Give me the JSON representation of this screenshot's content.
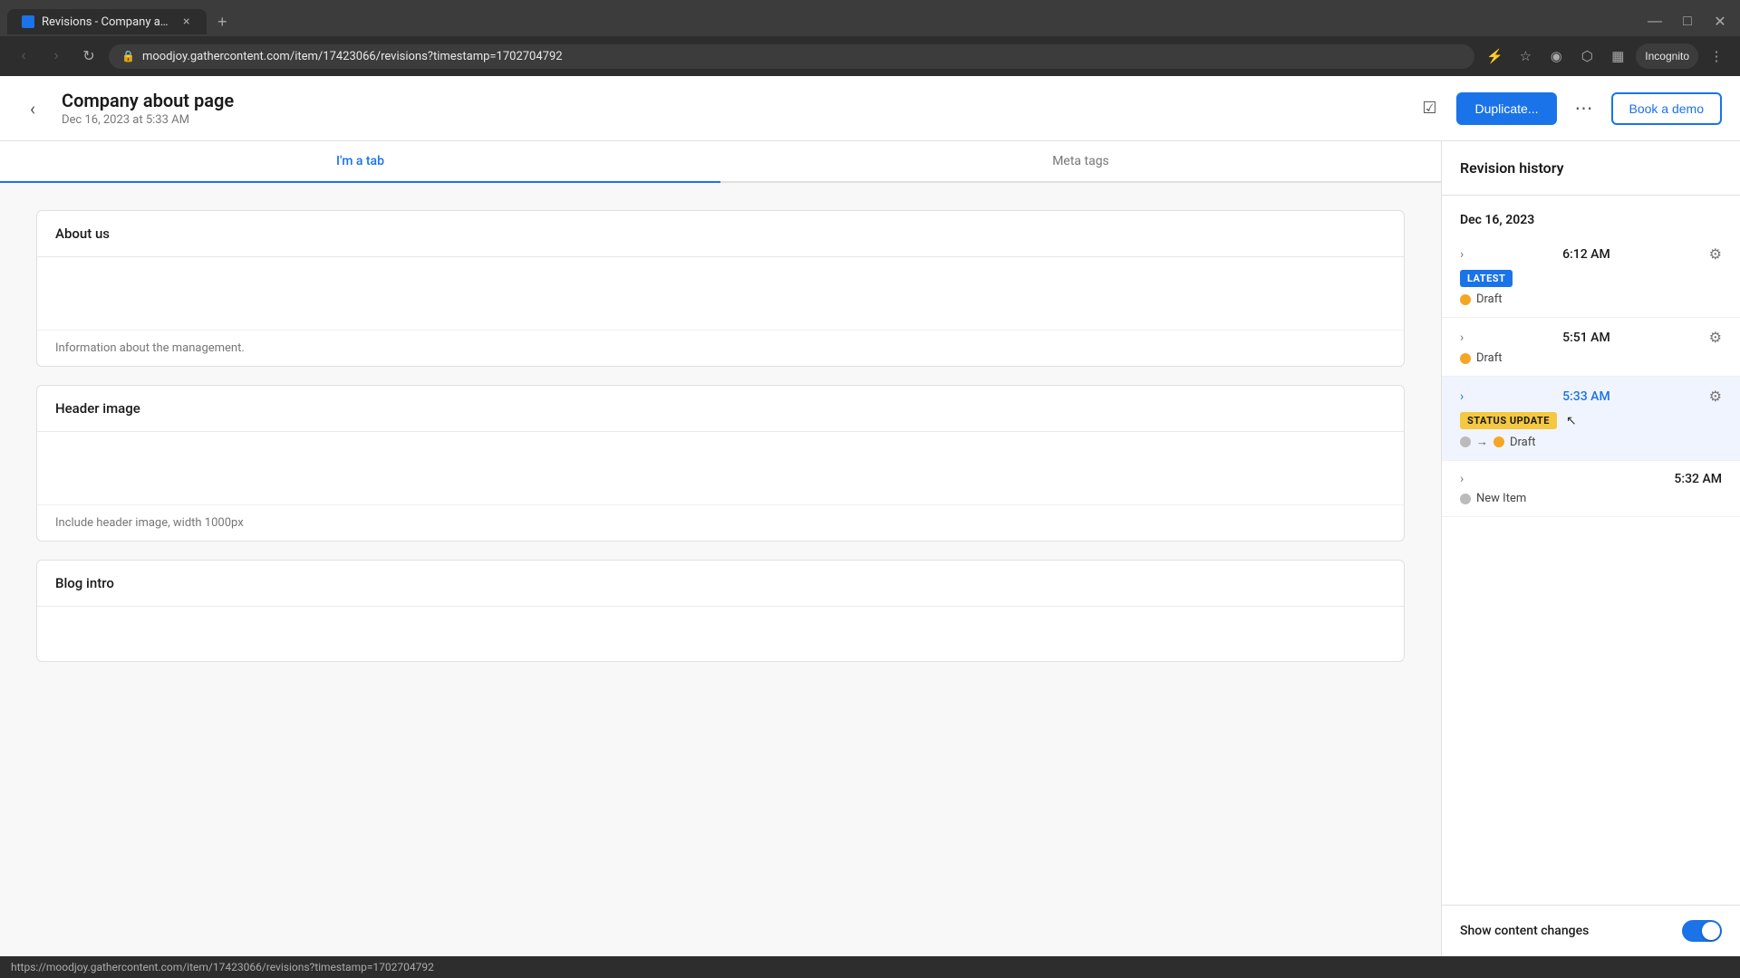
{
  "browser": {
    "tab": {
      "favicon_bg": "#1a73e8",
      "title": "Revisions - Company about pa...",
      "close_label": "×"
    },
    "add_tab_label": "+",
    "address": {
      "url_full": "moodjoy.gathercontent.com/item/17423066/revisions?timestamp=1702704792",
      "url_display": "moodjoy.gathercontent.com/item/17423066/revisions?timestamp=1702704792"
    },
    "incognito_label": "Incognito"
  },
  "app": {
    "header": {
      "title": "Company about page",
      "date": "Dec 16, 2023 at 5:33 AM",
      "duplicate_btn": "Duplicate...",
      "demo_btn": "Book a demo"
    },
    "tabs": [
      {
        "label": "I'm a tab",
        "active": true
      },
      {
        "label": "Meta tags",
        "active": false
      }
    ],
    "content_blocks": [
      {
        "title": "About us",
        "body": "",
        "footer": "Information about the management."
      },
      {
        "title": "Header image",
        "body": "",
        "footer": "Include header image, width 1000px"
      },
      {
        "title": "Blog intro",
        "body": "",
        "footer": ""
      }
    ]
  },
  "revision_sidebar": {
    "title": "Revision history",
    "date_group": "Dec 16, 2023",
    "items": [
      {
        "time": "6:12 AM",
        "time_color": "normal",
        "badges": [
          "LATEST"
        ],
        "status_row": [
          {
            "type": "dot",
            "color": "orange"
          },
          {
            "type": "text",
            "value": "Draft"
          }
        ]
      },
      {
        "time": "5:51 AM",
        "time_color": "normal",
        "badges": [],
        "status_row": [
          {
            "type": "dot",
            "color": "orange"
          },
          {
            "type": "text",
            "value": "Draft"
          }
        ]
      },
      {
        "time": "5:33 AM",
        "time_color": "blue",
        "badges": [
          "STATUS UPDATE"
        ],
        "status_row": [
          {
            "type": "dot",
            "color": "gray"
          },
          {
            "type": "arrow",
            "value": "→"
          },
          {
            "type": "dot",
            "color": "orange"
          },
          {
            "type": "text",
            "value": "Draft"
          }
        ],
        "highlighted": true
      },
      {
        "time": "5:32 AM",
        "time_color": "normal",
        "badges": [],
        "status_row": [
          {
            "type": "dot",
            "color": "gray"
          },
          {
            "type": "text",
            "value": "New Item"
          }
        ]
      }
    ],
    "footer": {
      "label": "Show content changes",
      "toggle_on": true
    }
  },
  "status_bar": {
    "url": "https://moodjoy.gathercontent.com/item/17423066/revisions?timestamp=1702704792"
  }
}
